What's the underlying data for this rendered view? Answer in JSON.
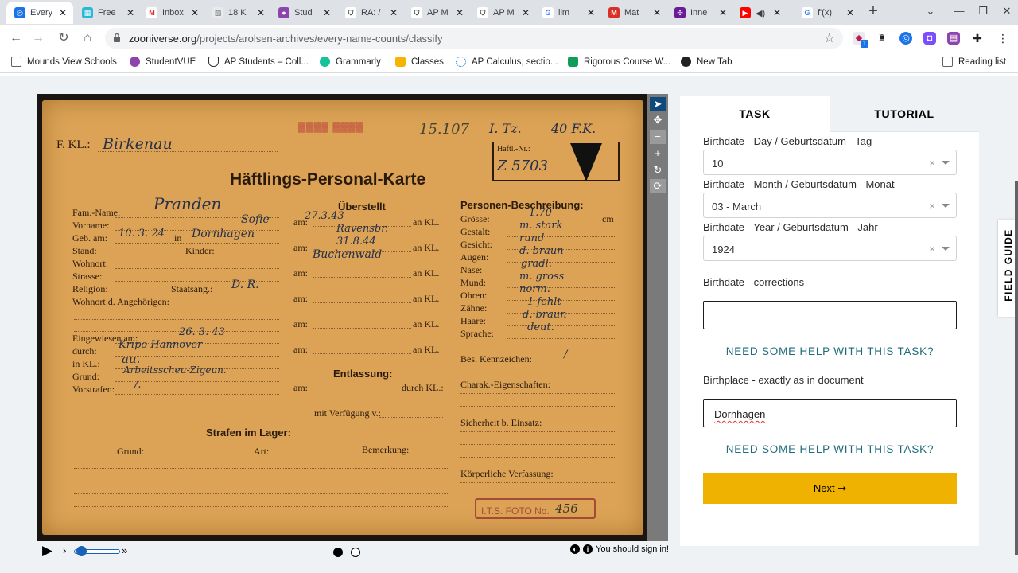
{
  "browser": {
    "tabs": [
      {
        "title": "Every",
        "color": "#1a73e8",
        "glyph": "⊙"
      },
      {
        "title": "Free",
        "color": "#2ab8d6",
        "glyph": "▦"
      },
      {
        "title": "Inbox",
        "color": "#ffffff",
        "glyph": "M"
      },
      {
        "title": "18 K",
        "color": "#e8eaed",
        "glyph": "▧"
      },
      {
        "title": "Stud",
        "color": "#8e44ad",
        "glyph": "●"
      },
      {
        "title": "RA: /",
        "color": "#ffffff",
        "glyph": "⛉"
      },
      {
        "title": "AP M",
        "color": "#ffffff",
        "glyph": "⛉"
      },
      {
        "title": "AP M",
        "color": "#ffffff",
        "glyph": "⛉"
      },
      {
        "title": "lim",
        "color": "#ffffff",
        "glyph": "G"
      },
      {
        "title": "Mat",
        "color": "#d93025",
        "glyph": "M"
      },
      {
        "title": "Inne",
        "color": "#6a1b9a",
        "glyph": "✣"
      },
      {
        "title": "",
        "color": "#ff0000",
        "glyph": "▶"
      },
      {
        "title": "f'(x)",
        "color": "#ffffff",
        "glyph": "G"
      }
    ],
    "url_domain": "zooniverse.org",
    "url_path": "/projects/arolsen-archives/every-name-counts/classify",
    "bookmarks": [
      "Mounds View Schools",
      "StudentVUE",
      "AP Students – Coll...",
      "Grammarly",
      "Classes",
      "AP Calculus, sectio...",
      "Rigorous Course W...",
      "New Tab"
    ],
    "reading_list": "Reading list",
    "extension_badge": "1"
  },
  "document": {
    "camp_label": "F. KL.:",
    "camp_value": "Birkenau",
    "stamp_top": "15.107",
    "stamp_top2": "I. Tz.",
    "haeft_nr_label": "Häftl.-Nr.:",
    "haeft_nr_value": "Z 5703",
    "title": "Häftlings-Personal-Karte",
    "fields_left": [
      "Fam.-Name:",
      "Vorname:",
      "Geb. am:",
      "Stand:",
      "Wohnort:",
      "Strasse:",
      "Religion:",
      "Wohnort d. Angehörigen:"
    ],
    "fam_name": "Pranden",
    "vorname": "Sofie",
    "geb_am": "10. 3. 24",
    "geb_in": "in",
    "geb_ort": "Dornhagen",
    "kinder": "Kinder:",
    "staatsang": "Staatsang.:",
    "staatsang_val": "D. R.",
    "ueberstellt": "Überstellt",
    "am": "am:",
    "an_kl": "an KL.",
    "transfer1_place": "Ravensbr.",
    "transfer2_date": "31.8.44",
    "transfer2_place": "Buchenwald",
    "eingewiesen": "Eingewiesen am:",
    "eingewiesen_val": "26. 3. 43",
    "durch": "durch:",
    "durch_val": "Kripo Hannover",
    "in_kl": "in KL.:",
    "in_kl_val": "au.",
    "grund": "Grund:",
    "grund_val": "Arbeitsscheu-Zigeun.",
    "vorstrafen": "Vorstrafen:",
    "vorstrafen_val": "/.",
    "entlassung": "Entlassung:",
    "durch_kl": "durch KL.:",
    "mit_verfuegung": "mit Verfügung v.:",
    "strafen_title": "Strafen im Lager:",
    "strafen_cols": [
      "Grund:",
      "Art:",
      "Bemerkung:"
    ],
    "personen_title": "Personen-Beschreibung:",
    "personen_fields": [
      "Grösse:",
      "Gestalt:",
      "Gesicht:",
      "Augen:",
      "Nase:",
      "Mund:",
      "Ohren:",
      "Zähne:",
      "Haare:",
      "Sprache:"
    ],
    "personen_values": [
      "1.70",
      "m. stark",
      "rund",
      "d. braun",
      "gradl.",
      "m. gross",
      "norm.",
      "1 fehlt",
      "d. braun",
      "deut."
    ],
    "cm": "cm",
    "bes_kennzeichen": "Bes. Kennzeichen:",
    "charak": "Charak.-Eigenschaften:",
    "sicherheit": "Sicherheit b. Einsatz:",
    "koerperliche": "Körperliche Verfassung:",
    "foto_stamp": "I.T.S. FOTO No.",
    "foto_no": "456"
  },
  "viewer": {
    "signin_text": "You should sign in!"
  },
  "panel": {
    "tab_task": "TASK",
    "tab_tutorial": "TUTORIAL",
    "day_label": "Birthdate - Day / Geburtsdatum - Tag",
    "day_value": "10",
    "month_label": "Birthdate - Month / Geburtsdatum - Monat",
    "month_value": "03 - March",
    "year_label": "Birthdate - Year / Geburtsdatum - Jahr",
    "year_value": "1924",
    "corrections_label": "Birthdate - corrections",
    "corrections_value": "",
    "help_link": "NEED SOME HELP WITH THIS TASK?",
    "birthplace_label": "Birthplace - exactly as in document",
    "birthplace_value": "Dornhagen",
    "next_label": "Next ➞",
    "clear_glyph": "×"
  },
  "field_guide": "FIELD GUIDE",
  "colors": {
    "accent": "#f0b200",
    "link": "#1d6b79",
    "tool_active": "#0f4a7a"
  }
}
